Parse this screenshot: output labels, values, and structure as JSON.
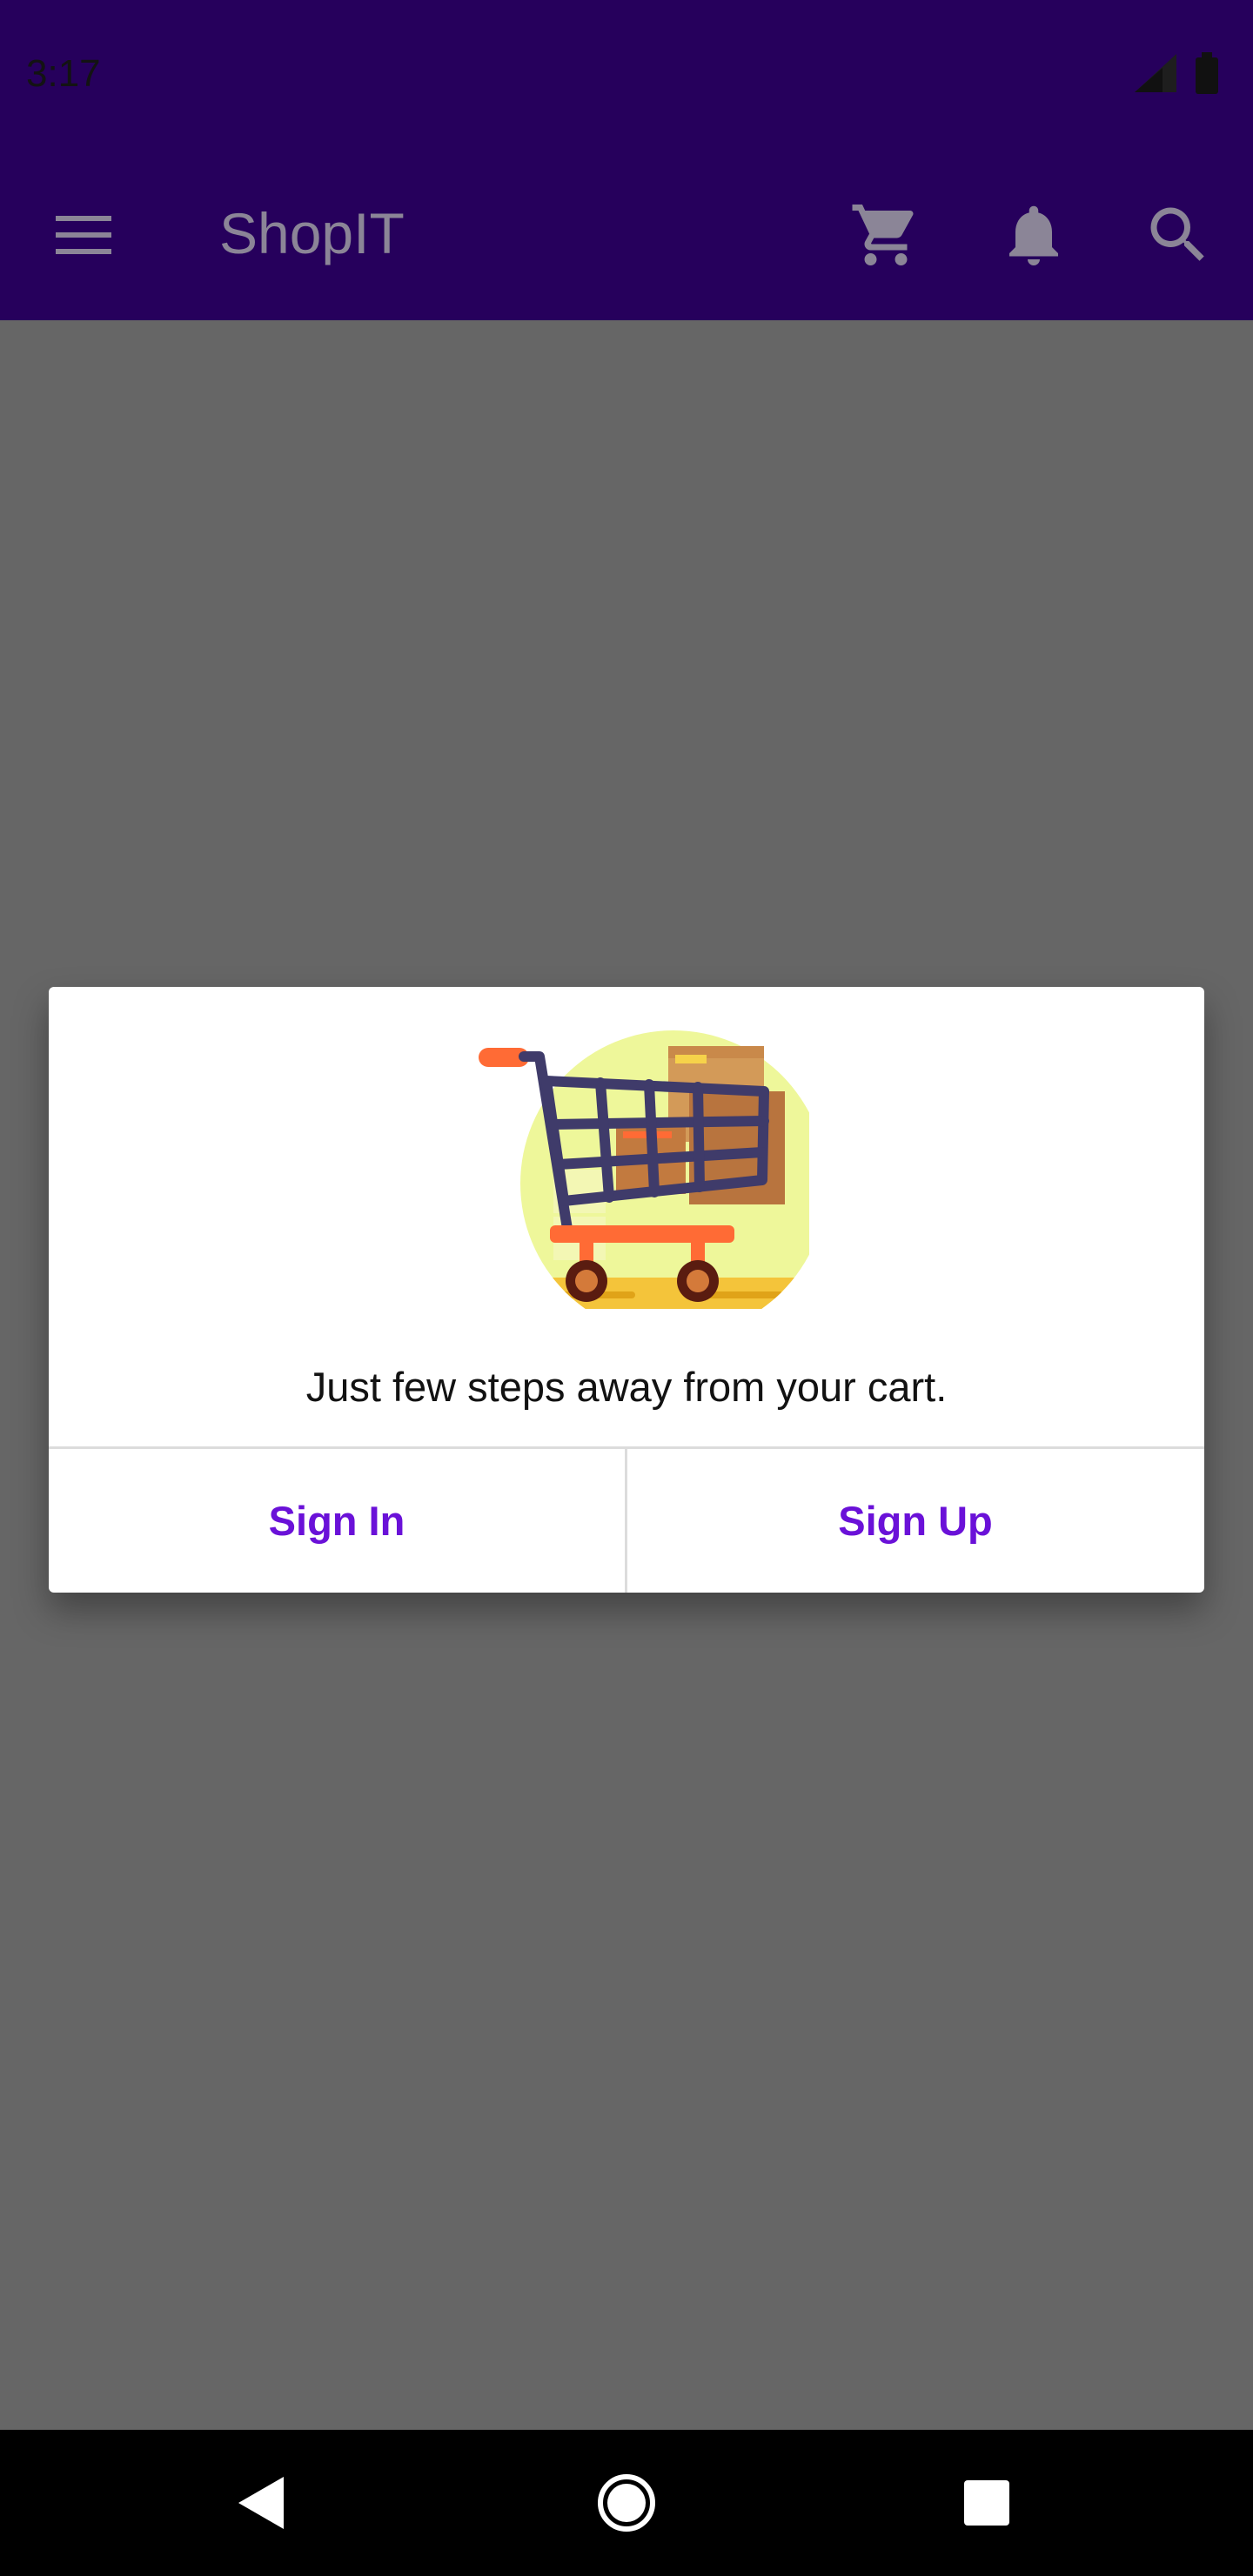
{
  "status_bar": {
    "time": "3:17",
    "icons": [
      "signal-icon",
      "battery-icon"
    ]
  },
  "app_bar": {
    "title": "ShopIT",
    "icons": [
      "menu-icon",
      "cart-icon",
      "bell-icon",
      "search-icon"
    ]
  },
  "dialog": {
    "message": "Just few steps away from your cart.",
    "sign_in_label": "Sign In",
    "sign_up_label": "Sign Up",
    "illustration": "shopping-cart-illustration"
  },
  "nav_bar": {
    "icons": [
      "back-icon",
      "home-icon",
      "recents-icon"
    ]
  },
  "colors": {
    "app_bar_bg": "#26005c",
    "overlay": "#666666",
    "accent": "#6a11d8",
    "dialog_bg": "#ffffff"
  }
}
